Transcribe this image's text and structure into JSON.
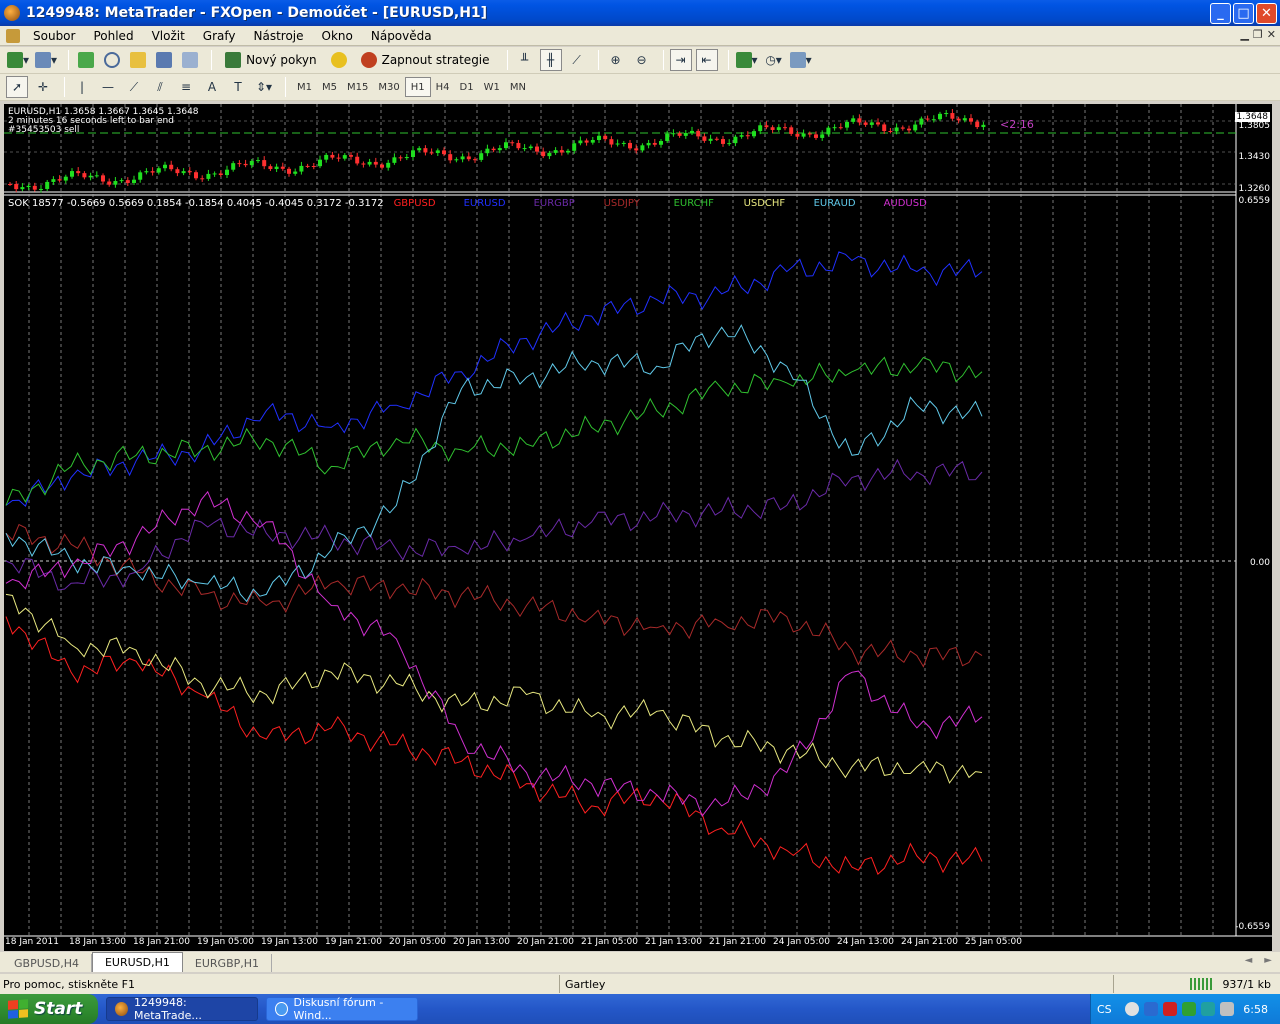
{
  "window": {
    "title": "1249948: MetaTrader - FXOpen - Demoúčet - [EURUSD,H1]"
  },
  "menu": [
    "Soubor",
    "Pohled",
    "Vložit",
    "Grafy",
    "Nástroje",
    "Okno",
    "Nápověda"
  ],
  "toolbar1": {
    "new_order": "Nový pokyn",
    "enable_strategies": "Zapnout strategie"
  },
  "timeframes": [
    "M1",
    "M5",
    "M15",
    "M30",
    "H1",
    "H4",
    "D1",
    "W1",
    "MN"
  ],
  "timeframe_active": "H1",
  "upper_chart": {
    "info_line": "EURUSD,H1  1.3658 1.3667 1.3645 1.3648",
    "timer_line": "2 minutes 16 seconds left to bar end",
    "order_line": "#35453503 sell",
    "timer_mark": "<2:16",
    "price_current": "1.3648",
    "price_top": "1.3805",
    "price_mid": "1.3430",
    "price_low": "1.3260"
  },
  "indicator": {
    "header": "SOK 18577 -0.5669 0.5669 0.1854 -0.1854 0.4045 -0.4045 0.3172 -0.3172",
    "scale_top": "0.6559",
    "scale_zero": "0.00",
    "scale_bottom": "-0.6559"
  },
  "chart_data": {
    "type": "line",
    "x": [
      "18 Jan 2011",
      "18 Jan 13:00",
      "18 Jan 21:00",
      "19 Jan 05:00",
      "19 Jan 13:00",
      "19 Jan 21:00",
      "20 Jan 05:00",
      "20 Jan 13:00",
      "20 Jan 21:00",
      "21 Jan 05:00",
      "21 Jan 13:00",
      "21 Jan 21:00",
      "24 Jan 05:00",
      "24 Jan 13:00",
      "24 Jan 21:00",
      "25 Jan 05:00"
    ],
    "ylim": [
      -0.6559,
      0.6559
    ],
    "series": [
      {
        "name": "GBPUSD",
        "color": "#ff2020",
        "values": [
          -0.1,
          -0.2,
          -0.18,
          -0.24,
          -0.32,
          -0.3,
          -0.33,
          -0.36,
          -0.4,
          -0.44,
          -0.42,
          -0.48,
          -0.52,
          -0.55,
          -0.53,
          -0.54
        ]
      },
      {
        "name": "EURUSD",
        "color": "#2030ff",
        "values": [
          0.1,
          0.15,
          0.18,
          0.2,
          0.27,
          0.24,
          0.28,
          0.34,
          0.4,
          0.44,
          0.47,
          0.48,
          0.52,
          0.54,
          0.52,
          0.52
        ]
      },
      {
        "name": "EURGBP",
        "color": "#6a2aa8",
        "values": [
          0.0,
          -0.04,
          -0.02,
          0.07,
          0.05,
          0.04,
          0.02,
          0.02,
          0.04,
          0.07,
          0.08,
          0.09,
          0.1,
          0.15,
          0.16,
          0.16
        ]
      },
      {
        "name": "USDJPY",
        "color": "#a82a2a",
        "values": [
          0.05,
          0.03,
          -0.02,
          -0.06,
          -0.08,
          -0.04,
          -0.05,
          -0.06,
          -0.08,
          -0.1,
          -0.12,
          -0.11,
          -0.1,
          -0.16,
          -0.17,
          -0.17
        ]
      },
      {
        "name": "EURCHF",
        "color": "#30c030",
        "values": [
          0.1,
          0.17,
          0.19,
          0.2,
          0.22,
          0.17,
          0.22,
          0.2,
          0.21,
          0.24,
          0.27,
          0.31,
          0.32,
          0.34,
          0.35,
          0.34
        ]
      },
      {
        "name": "USDCHF",
        "color": "#e8e880",
        "values": [
          -0.06,
          -0.15,
          -0.16,
          -0.22,
          -0.24,
          -0.2,
          -0.22,
          -0.26,
          -0.24,
          -0.28,
          -0.27,
          -0.32,
          -0.34,
          -0.37,
          -0.37,
          -0.38
        ]
      },
      {
        "name": "EURAUD",
        "color": "#60c8e8",
        "values": [
          0.05,
          0.0,
          -0.02,
          -0.04,
          -0.06,
          0.02,
          0.1,
          0.31,
          0.33,
          0.36,
          0.35,
          0.42,
          0.35,
          0.19,
          0.28,
          0.26
        ]
      },
      {
        "name": "AUDUSD",
        "color": "#d030d0",
        "values": [
          -0.04,
          -0.01,
          0.04,
          0.11,
          0.07,
          -0.08,
          -0.14,
          -0.32,
          -0.38,
          -0.4,
          -0.42,
          -0.44,
          -0.38,
          -0.2,
          -0.3,
          -0.28
        ]
      }
    ]
  },
  "tabs": [
    "GBPUSD,H4",
    "EURUSD,H1",
    "EURGBP,H1"
  ],
  "tab_active": "EURUSD,H1",
  "status": {
    "help": "Pro pomoc, stiskněte F1",
    "profile": "Gartley",
    "traffic": "937/1 kb"
  },
  "taskbar": {
    "start": "Start",
    "tasks": [
      "1249948: MetaTrade...",
      "Diskusní fórum - Wind..."
    ],
    "lang": "CS",
    "clock": "6:58"
  }
}
